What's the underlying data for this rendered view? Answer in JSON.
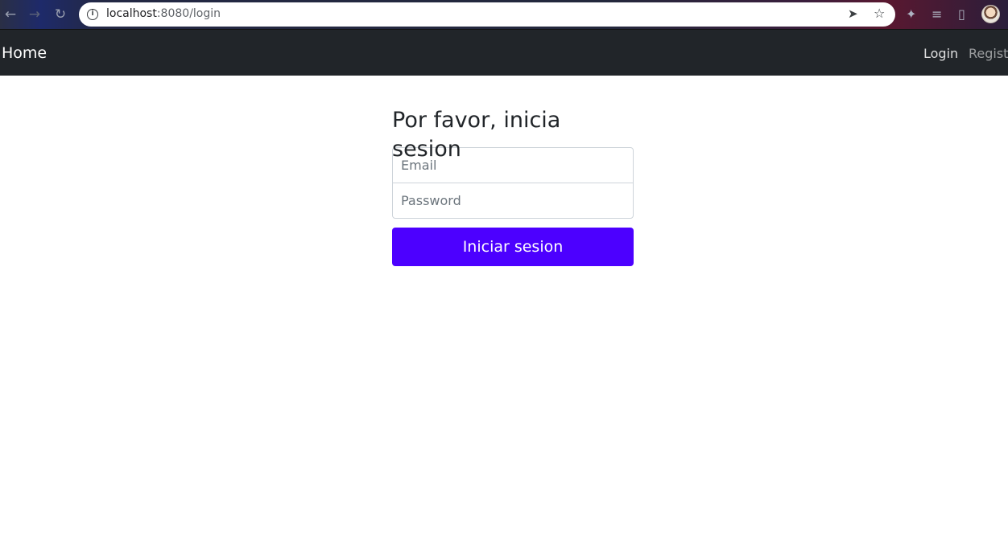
{
  "browser": {
    "url_host": "localhost",
    "url_rest": ":8080/login",
    "back_icon": "←",
    "forward_icon": "→",
    "reload_icon": "↻",
    "info_icon": "i",
    "send_icon": "➤",
    "star_icon": "☆",
    "extensions_icon": "✦",
    "media_icon": "≡",
    "sidepanel_icon": "▯"
  },
  "navbar": {
    "brand": "Home",
    "login": "Login",
    "register": "Register"
  },
  "form": {
    "title": "Por favor, inicia sesion",
    "email_placeholder": "Email",
    "password_placeholder": "Password",
    "submit": "Iniciar sesion"
  },
  "colors": {
    "navbar_bg": "#212529",
    "primary_button": "#4c00ff"
  }
}
